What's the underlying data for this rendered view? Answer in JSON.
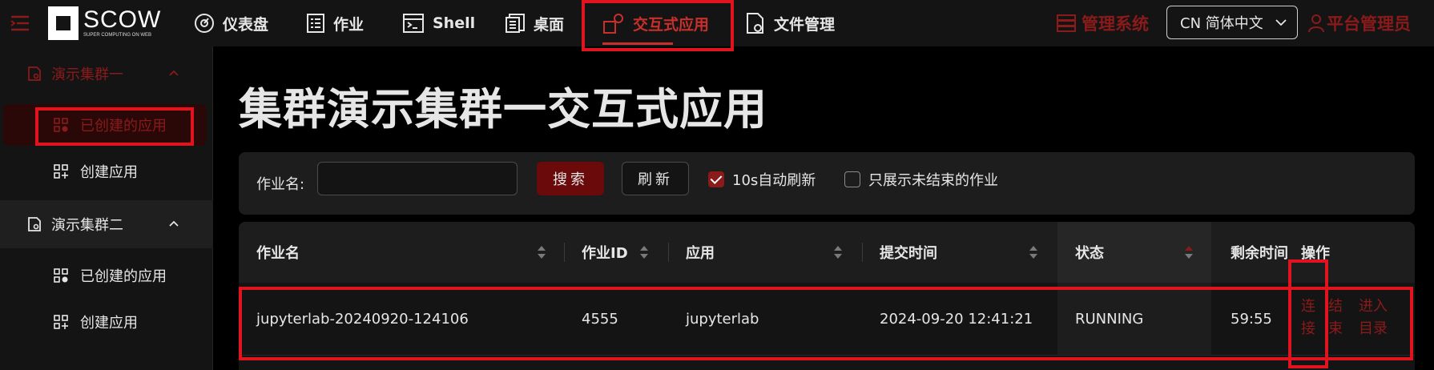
{
  "header": {
    "logo": {
      "text": "SCOW",
      "subtitle": "SUPER COMPUTING ON WEB"
    },
    "nav": [
      {
        "label": "仪表盘",
        "icon": "dashboard-icon"
      },
      {
        "label": "作业",
        "icon": "job-icon"
      },
      {
        "label": "Shell",
        "icon": "terminal-icon"
      },
      {
        "label": "桌面",
        "icon": "desktop-icon"
      },
      {
        "label": "交互式应用",
        "icon": "apps-icon",
        "active": true
      },
      {
        "label": "文件管理",
        "icon": "file-manager-icon"
      }
    ],
    "admin_label": "管理系统",
    "language": "CN 简体中文",
    "user_label": "平台管理员"
  },
  "sidebar": {
    "groups": [
      {
        "label": "演示集群一",
        "expanded": true,
        "items": [
          {
            "label": "已创建的应用",
            "selected": true
          },
          {
            "label": "创建应用"
          }
        ]
      },
      {
        "label": "演示集群二",
        "expanded": true,
        "items": [
          {
            "label": "已创建的应用"
          },
          {
            "label": "创建应用"
          }
        ]
      }
    ]
  },
  "main": {
    "title": "集群演示集群一交互式应用",
    "filter": {
      "job_name_label": "作业名:",
      "job_name_value": "",
      "search_label": "搜索",
      "refresh_label": "刷新",
      "auto_refresh_label": "10s自动刷新",
      "auto_refresh_checked": true,
      "only_unfinished_label": "只展示未结束的作业",
      "only_unfinished_checked": false
    },
    "table": {
      "columns": [
        "作业名",
        "作业ID",
        "应用",
        "提交时间",
        "状态",
        "剩余时间",
        "操作"
      ],
      "rows": [
        {
          "job_name": "jupyterlab-20240920-124106",
          "job_id": "4555",
          "app": "jupyterlab",
          "submit_time": "2024-09-20 12:41:21",
          "status": "RUNNING",
          "remaining": "59:55",
          "actions": {
            "connect": [
              "连",
              "接"
            ],
            "finish": [
              "结",
              "束"
            ],
            "enter_dir": [
              "进入",
              "目录"
            ]
          }
        }
      ]
    }
  },
  "colors": {
    "accent": "#c9302c",
    "accent_dark": "#8b1a1a",
    "highlight": "#e0141e"
  }
}
